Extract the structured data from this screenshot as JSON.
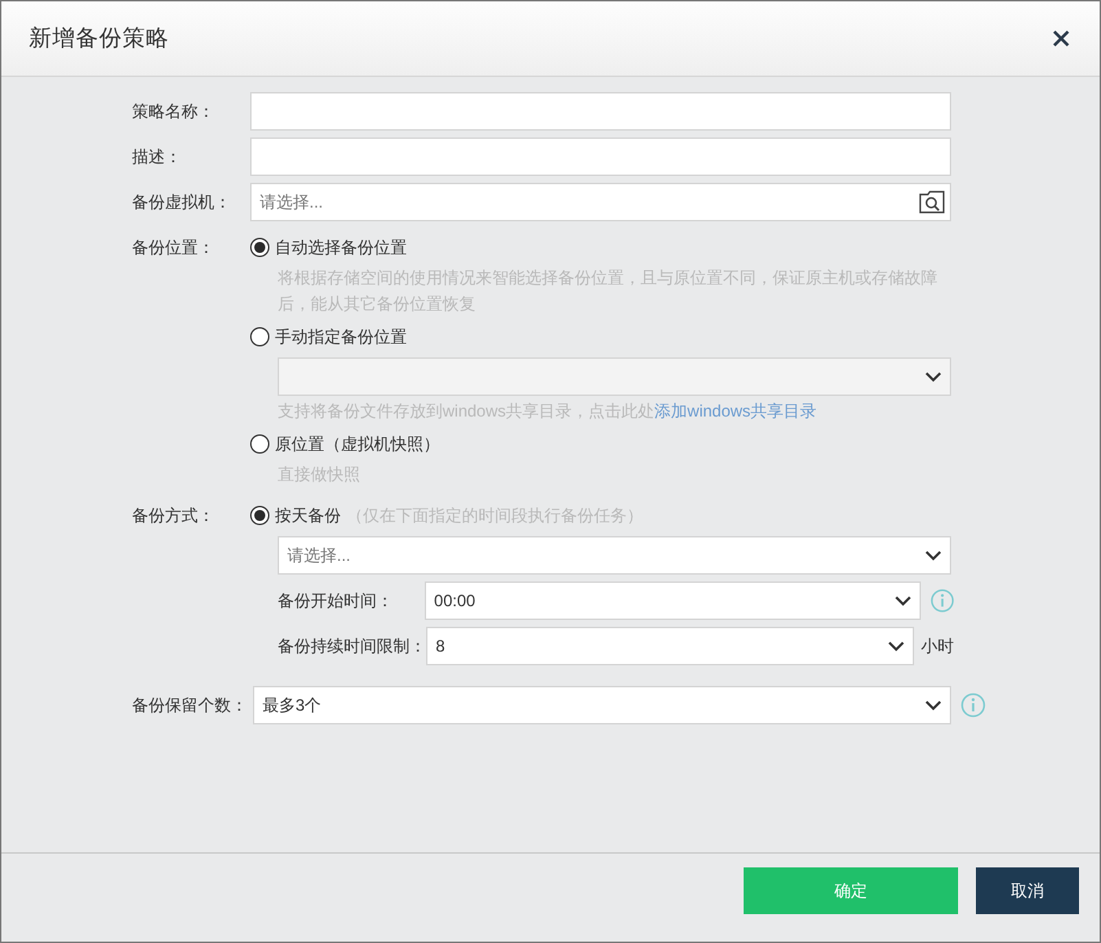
{
  "dialog": {
    "title": "新增备份策略"
  },
  "name_field": {
    "label": "策略名称："
  },
  "description_field": {
    "label": "描述："
  },
  "vm_field": {
    "label": "备份虚拟机：",
    "placeholder": "请选择..."
  },
  "location": {
    "label": "备份位置：",
    "options": [
      {
        "label": "自动选择备份位置",
        "selected": true,
        "hint": "将根据存储空间的使用情况来智能选择备份位置，且与原位置不同，保证原主机或存储故障后，能从其它备份位置恢复"
      },
      {
        "label": "手动指定备份位置",
        "selected": false,
        "select": {
          "disabled": true
        },
        "hint": "支持将备份文件存放到windows共享目录，点击此处",
        "link": "添加windows共享目录"
      },
      {
        "label": "原位置（虚拟机快照）",
        "selected": false,
        "hint": "直接做快照"
      }
    ]
  },
  "method": {
    "label": "备份方式：",
    "options": [
      {
        "label": "按天备份",
        "selected": true,
        "note": "（仅在下面指定的时间段执行备份任务）"
      }
    ],
    "schedule": {
      "placeholder": "请选择..."
    },
    "start_time": {
      "label": "备份开始时间：",
      "value": "00:00",
      "info": true
    },
    "duration": {
      "label": "备份持续时间限制：",
      "value": "8",
      "unit": "小时"
    }
  },
  "retention": {
    "label": "备份保留个数：",
    "value": "最多3个",
    "info": true
  },
  "buttons": [
    {
      "label": "确定",
      "kind": "primary"
    },
    {
      "label": "取消",
      "kind": "secondary"
    }
  ]
}
